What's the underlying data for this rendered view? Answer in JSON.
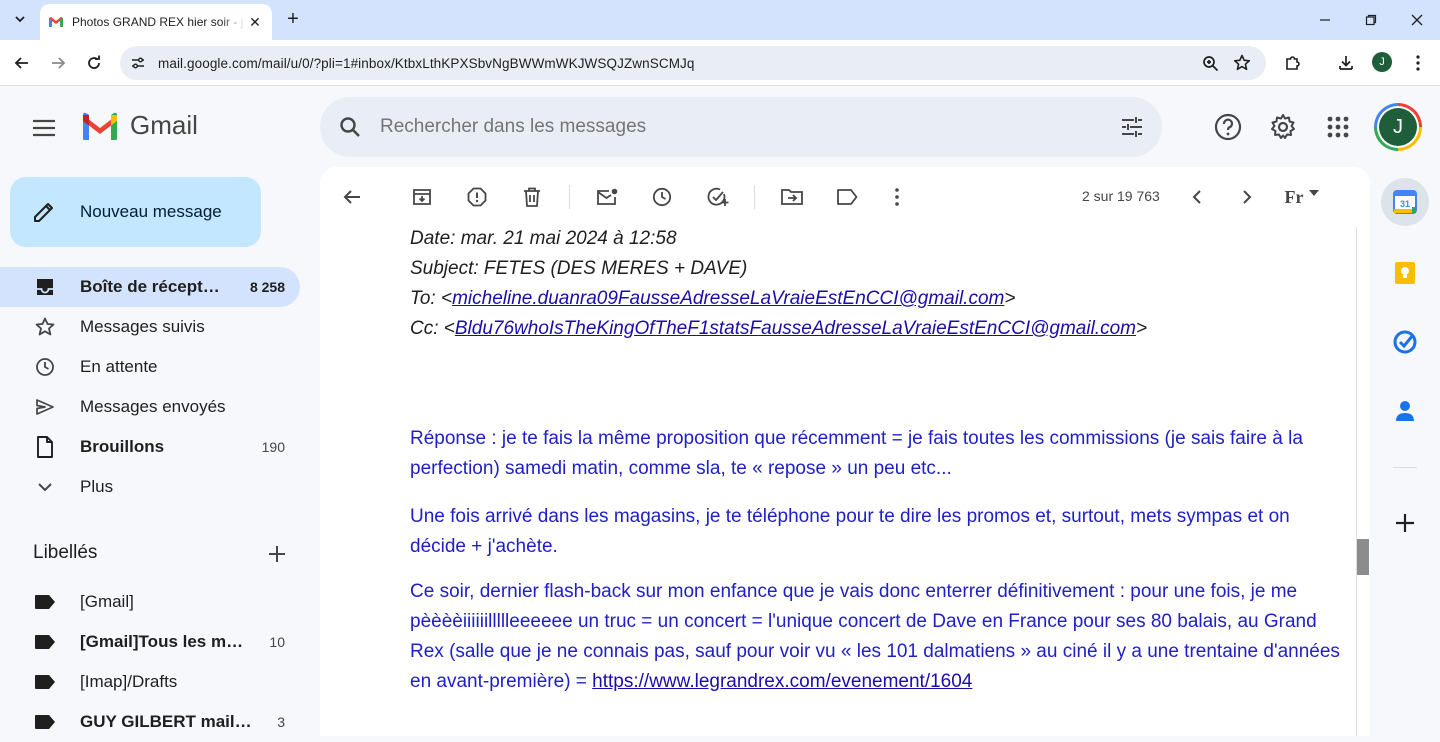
{
  "browser": {
    "tab_title": "Photos GRAND REX hier soir - j",
    "url": "mail.google.com/mail/u/0/?pli=1#inbox/KtbxLthKPXSbvNgBWWmWKJWSQJZwnSCMJq",
    "profile_initial": "J"
  },
  "gmail": {
    "logo_text": "Gmail",
    "search_placeholder": "Rechercher dans les messages",
    "avatar_initial": "J"
  },
  "sidebar": {
    "compose_label": "Nouveau message",
    "items": [
      {
        "label": "Boîte de récept…",
        "count": "8 258"
      },
      {
        "label": "Messages suivis",
        "count": ""
      },
      {
        "label": "En attente",
        "count": ""
      },
      {
        "label": "Messages envoyés",
        "count": ""
      },
      {
        "label": "Brouillons",
        "count": "190"
      },
      {
        "label": "Plus",
        "count": ""
      }
    ],
    "labels_title": "Libellés",
    "labels": [
      {
        "label": "[Gmail]",
        "count": ""
      },
      {
        "label": "[Gmail]Tous les m…",
        "count": "10"
      },
      {
        "label": "[Imap]/Drafts",
        "count": ""
      },
      {
        "label": "GUY GILBERT mail…",
        "count": "3"
      }
    ]
  },
  "toolbar": {
    "pager_text": "2 sur 19 763",
    "lang_label": "Fr"
  },
  "message": {
    "date_line": "Date: mar. 21 mai 2024 à 12:58",
    "subject_line": "Subject: FETES (DES MERES + DAVE)",
    "to_prefix": "To: <",
    "to_email": "micheline.duanra09FausseAdresseLaVraieEstEnCCI@gmail.com",
    "to_suffix": ">",
    "cc_prefix": "Cc: <",
    "cc_email": "Bldu76whoIsTheKingOfTheF1statsFausseAdresseLaVraieEstEnCCI@gmail.com",
    "cc_suffix": ">",
    "para1": "Réponse : je te fais la même proposition que récemment = je fais toutes les commissions (je sais faire à la perfection) samedi matin, comme sla, te « repose » un peu etc...",
    "para2": "Une fois arrivé dans les magasins, je te téléphone pour te dire les promos et, surtout, mets sympas et on décide + j'achète.",
    "para3": "Ce soir, dernier flash-back sur mon enfance que je vais donc enterrer définitivement : pour une fois, je me pèèèèiiiiiillllleeeeee un truc = un concert = l'unique concert de Dave en France pour ses 80 balais, au Grand Rex (salle que je ne connais pas, sauf pour voir vu « les 101 dalmatiens » au ciné il y a une trentaine d'années en avant-première) = ",
    "para3_link": "https://www.legrandrex.com/evenement/1604"
  }
}
